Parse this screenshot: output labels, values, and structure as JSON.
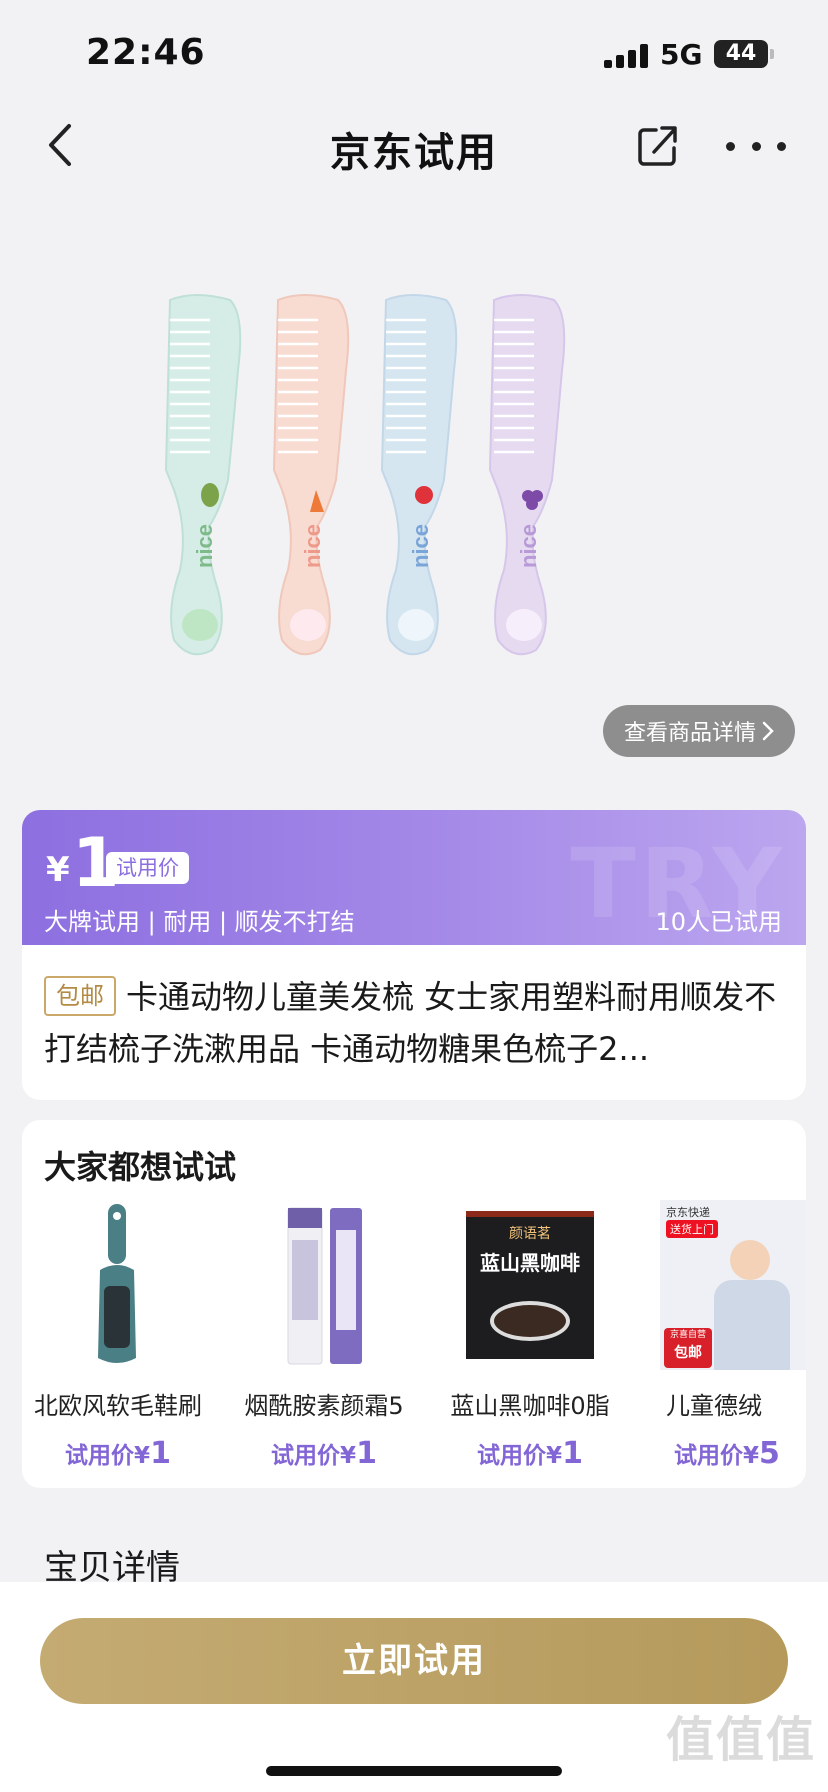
{
  "status": {
    "time": "22:46",
    "network": "5G",
    "battery": "44"
  },
  "nav": {
    "title": "京东试用",
    "back_icon": "chevron-left-icon",
    "share_icon": "share-icon",
    "more_icon": "more-icon"
  },
  "product": {
    "view_details": "查看商品详情",
    "price_currency": "¥",
    "price_value": "1",
    "price_tag": "试用价",
    "features": "大牌试用 | 耐用 | 顺发不打结",
    "trial_count": "10人已试用",
    "free_shipping": "包邮",
    "title": "卡通动物儿童美发梳 女士家用塑料耐用顺发不打结梳子洗漱用品 卡通动物糖果色梳子2..."
  },
  "recommend": {
    "title": "大家都想试试",
    "items": [
      {
        "name": "北欧风软毛鞋刷",
        "price_label": "试用价¥",
        "price": "1"
      },
      {
        "name": "烟酰胺素颜霜5",
        "price_label": "试用价¥",
        "price": "1"
      },
      {
        "name": "蓝山黑咖啡0脂",
        "price_label": "试用价¥",
        "price": "1"
      },
      {
        "name": "儿童德绒",
        "price_label": "试用价¥",
        "price": "5"
      }
    ],
    "coffee_box_text": "蓝山黑咖啡",
    "coffee_brand": "颜语茗",
    "kids_express": "京东快递",
    "kids_express_sub": "送货上门",
    "kids_badge": "包邮",
    "kids_badge_top": "京喜自营"
  },
  "detail_section": {
    "title": "宝贝详情"
  },
  "cta": {
    "label": "立即试用"
  },
  "watermark": {
    "corner": "值值值",
    "band": "TRY"
  },
  "comb_text": "nice",
  "colors": {
    "accent": "#8d6fe0",
    "gold": "#c4ab72",
    "price_text": "#8366d6"
  }
}
